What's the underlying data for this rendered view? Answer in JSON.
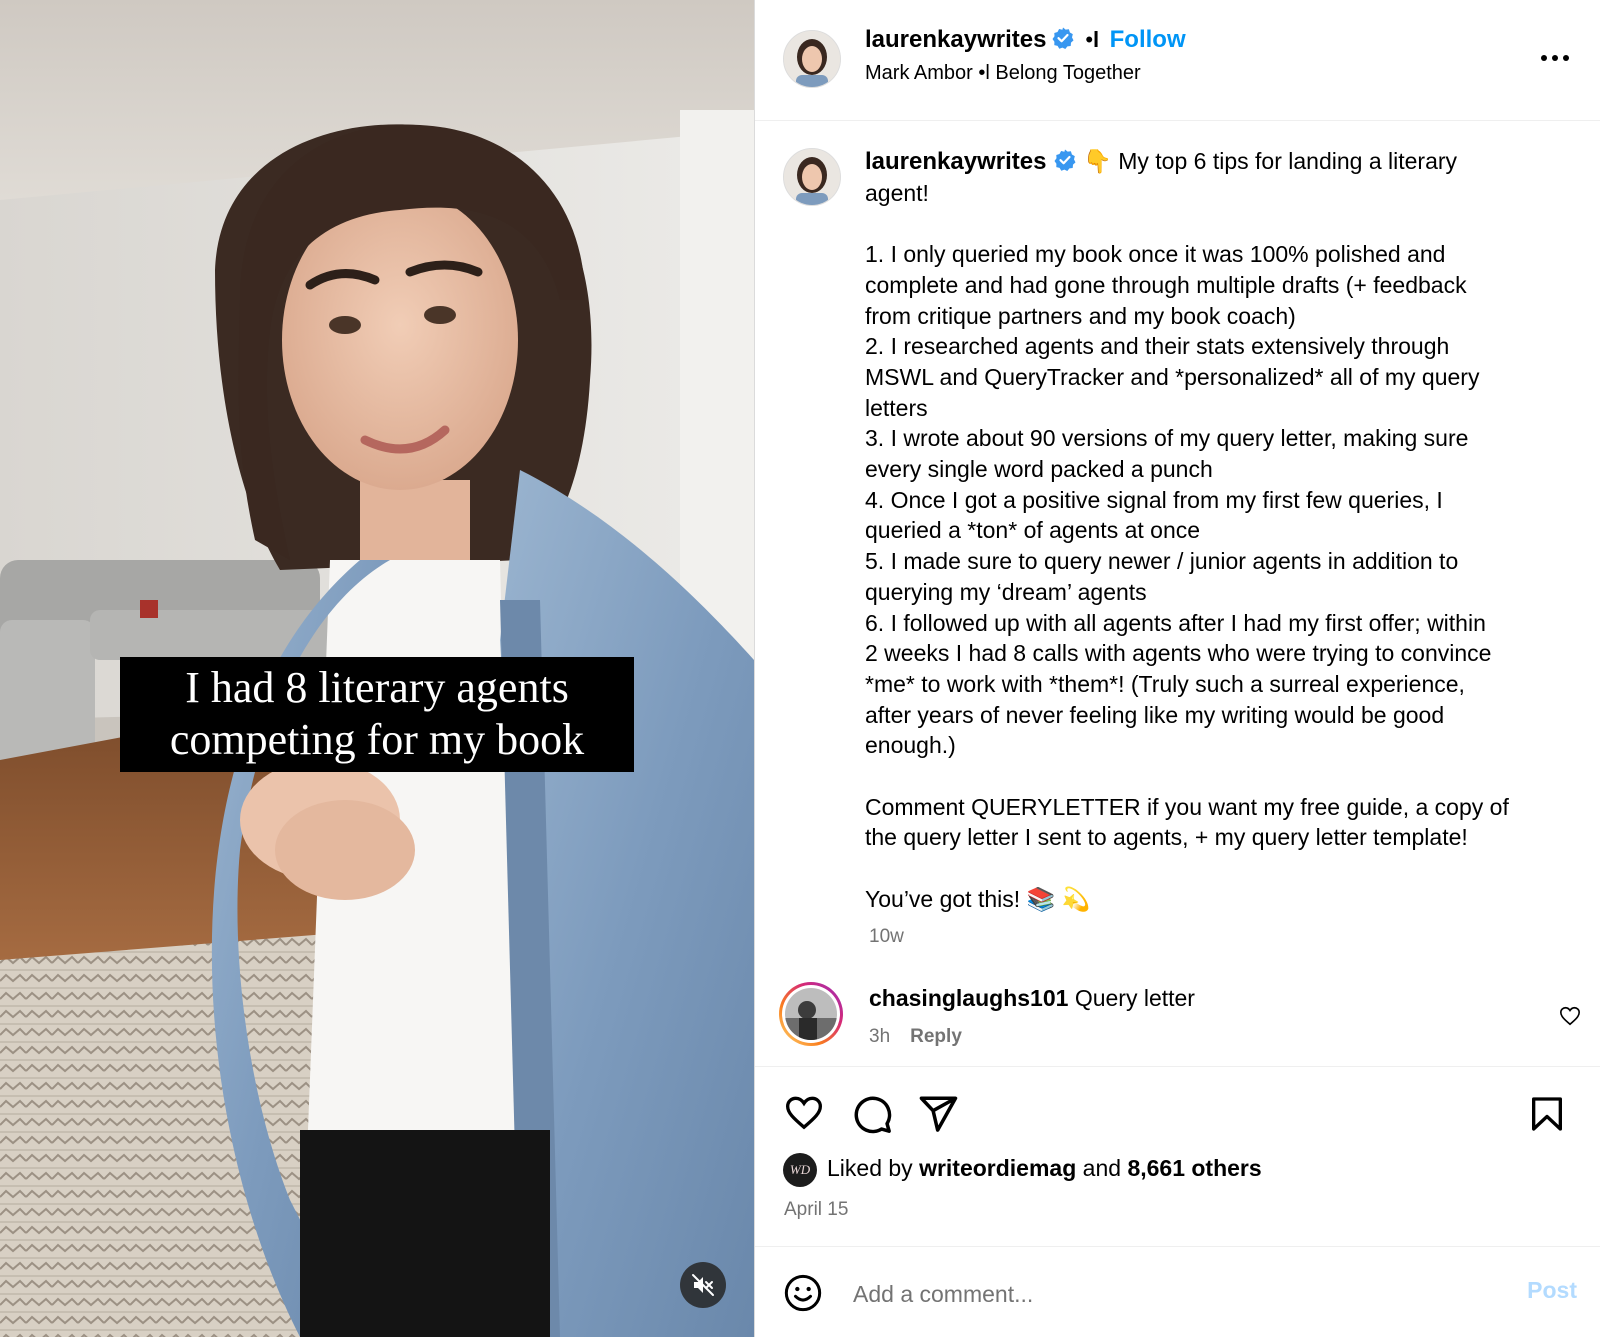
{
  "video": {
    "overlay_lines": [
      "I had 8 literary agents",
      "competing for my book"
    ],
    "mute_icon": "speaker-muted-icon"
  },
  "header": {
    "username": "laurenkaywrites",
    "dot": "•",
    "follow_label": "Follow",
    "audio": "Mark Ambor •l Belong Together",
    "more_icon": "more-options-icon"
  },
  "post": {
    "username": "laurenkaywrites",
    "caption_lines": [
      "👇 My top 6 tips for landing a literary",
      "agent!",
      "",
      "1. I only queried my book once it was 100% polished and",
      "complete and had gone through multiple drafts (+ feedback",
      "from critique partners and my book coach)",
      "2. I researched agents and their stats extensively through",
      "MSWL and QueryTracker and *personalized* all of my query",
      "letters",
      "3. I wrote about 90 versions of my query letter, making sure",
      "every single word packed a punch",
      "4. Once I got a positive signal from my first few queries, I",
      "queried a *ton* of agents at once",
      "5. I made sure to query newer / junior agents in addition to",
      "querying my ‘dream’ agents",
      "6. I followed up with all agents after I had my first offer; within",
      "2 weeks I had 8 calls with agents who were trying to convince",
      "*me* to work with *them*! (Truly such a surreal experience,",
      "after years of never feeling like my writing would be good",
      "enough.)",
      "",
      "Comment QUERYLETTER if you want my free guide, a copy of",
      "the query letter I sent to agents, + my query letter template!",
      "",
      "You’ve got this! 📚 💫"
    ],
    "time_ago": "10w"
  },
  "comment": {
    "username": "chasinglaughs101",
    "text": "Query letter",
    "time": "3h",
    "reply_label": "Reply"
  },
  "actions": {
    "liked_by_prefix": "Liked by",
    "liked_by_user": "writeordiemag",
    "and_label": "and",
    "others": "8,661 others",
    "date": "April 15",
    "liker_avatar_text": "WD"
  },
  "add_comment": {
    "placeholder": "Add a comment...",
    "post_label": "Post"
  },
  "colors": {
    "accent": "#0095f6",
    "verified": "#3897f0",
    "muted_text": "#737373",
    "post_disabled": "#b3dbff"
  }
}
